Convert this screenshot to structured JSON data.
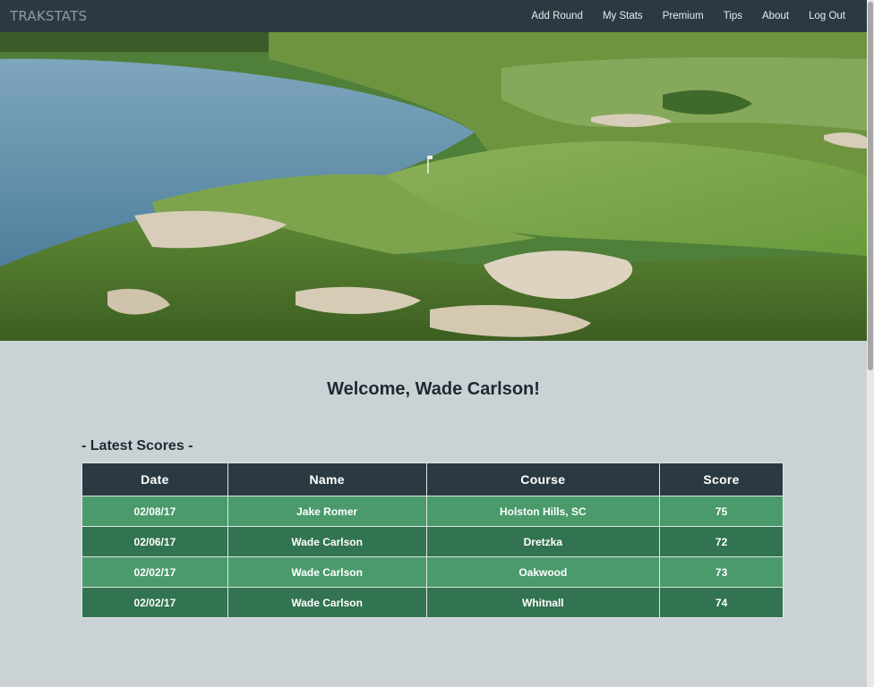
{
  "navbar": {
    "brand": "TRAKSTATS",
    "links": [
      "Add Round",
      "My Stats",
      "Premium",
      "Tips",
      "About",
      "Log Out"
    ]
  },
  "hero": {
    "alt": "golf course"
  },
  "welcome": "Welcome, Wade Carlson!",
  "scores": {
    "heading": "- Latest Scores -",
    "columns": [
      "Date",
      "Name",
      "Course",
      "Score"
    ],
    "rows": [
      [
        "02/08/17",
        "Jake Romer",
        "Holston Hills, SC",
        "75"
      ],
      [
        "02/06/17",
        "Wade Carlson",
        "Dretzka",
        "72"
      ],
      [
        "02/02/17",
        "Wade Carlson",
        "Oakwood",
        "73"
      ],
      [
        "02/02/17",
        "Wade Carlson",
        "Whitnall",
        "74"
      ]
    ]
  },
  "colors": {
    "navbar": "#2b3a42",
    "background": "#cbd2d6",
    "row_light": "#4a9a6b",
    "row_dark": "#327351"
  }
}
